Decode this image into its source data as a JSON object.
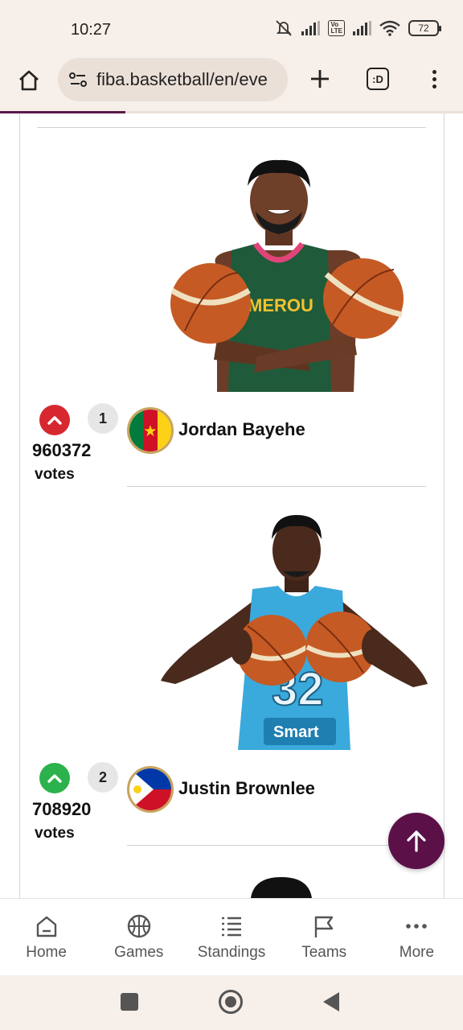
{
  "status_bar": {
    "time": "10:27",
    "battery": "72"
  },
  "browser": {
    "url": "fiba.basketball/en/eve",
    "tabs_label": ":D",
    "load_progress": 0.27
  },
  "players": [
    {
      "rank": "1",
      "votes": "960372",
      "votes_unit": "votes",
      "name": "Jordan Bayehe",
      "country": "Cameroon",
      "vote_state": "upvoted",
      "vote_color": "#d7282f",
      "jersey_text": "MEROU"
    },
    {
      "rank": "2",
      "votes": "708920",
      "votes_unit": "votes",
      "name": "Justin Brownlee",
      "country": "Philippines",
      "vote_state": "upvote",
      "vote_color": "#2bb24c",
      "jersey_number": "32",
      "jersey_sponsor": "Smart"
    }
  ],
  "bottom_nav": [
    {
      "label": "Home",
      "icon": "home-icon"
    },
    {
      "label": "Games",
      "icon": "basketball-icon"
    },
    {
      "label": "Standings",
      "icon": "list-icon"
    },
    {
      "label": "Teams",
      "icon": "flag-icon"
    },
    {
      "label": "More",
      "icon": "more-dots-icon"
    }
  ],
  "colors": {
    "brand": "#5b1047",
    "browser_bg": "#f7efe9",
    "upvote_red": "#d7282f",
    "upvote_green": "#2bb24c"
  }
}
